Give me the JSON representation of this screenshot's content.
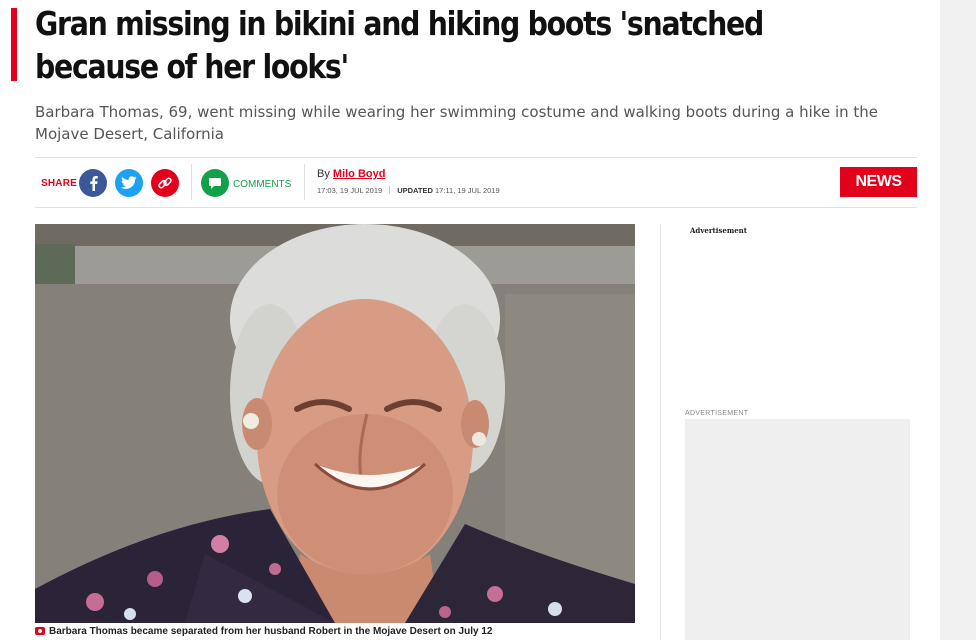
{
  "article": {
    "headline": "Gran missing in bikini and hiking boots 'snatched because of her looks'",
    "standfirst": "Barbara Thomas, 69, went missing while wearing her swimming costume and walking boots during a hike in the Mojave Desert, California",
    "share_label": "SHARE",
    "comments_label": "COMMENTS",
    "byline_prefix": "By",
    "author": "Milo Boyd",
    "published": "17:03, 19 JUL 2019",
    "updated_label": "UPDATED",
    "updated": "17:11, 19 JUL 2019",
    "section_badge": "NEWS",
    "caption": "Barbara Thomas became separated from her husband Robert in the Mojave Desert on July 12"
  },
  "sidebar": {
    "ad_label_top": "Advertisement",
    "ad_label_box": "ADVERTISEMENT"
  },
  "icons": {
    "facebook": "facebook-icon",
    "twitter": "twitter-icon",
    "link": "link-icon",
    "comments": "comment-icon",
    "camera": "camera-icon"
  },
  "colors": {
    "accent": "#e3001b",
    "facebook": "#3b5998",
    "twitter": "#1da1f2",
    "comments": "#12a04b"
  }
}
